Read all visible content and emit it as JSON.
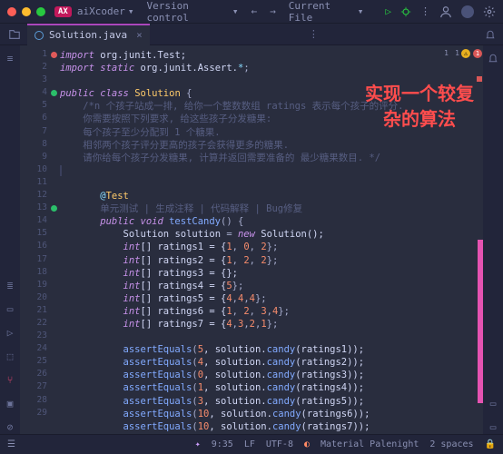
{
  "titlebar": {
    "brand_tag": "AX",
    "brand": "aiXcoder",
    "vc": "Version control",
    "run_cfg": "Current File"
  },
  "tab": {
    "name": "Solution.java"
  },
  "gutter": {
    "lines": [
      "1",
      "2",
      "3",
      "4",
      "5",
      "6",
      "7",
      "8",
      "9",
      "10",
      "11",
      "12",
      "13",
      "14",
      "15",
      "16",
      "17",
      "18",
      "19",
      "20",
      "21",
      "22",
      "23",
      "24",
      "25",
      "26",
      "27",
      "28",
      "29"
    ],
    "markers_active": [
      4,
      13
    ],
    "markers_error": [
      1
    ]
  },
  "code": {
    "l1a": "import",
    "l1b": " org.junit.Test;",
    "l2a": "import static",
    "l2b": " org.junit.Assert.",
    "l2c": "*",
    "l2d": ";",
    "l4a": "public class ",
    "l4b": "Solution",
    "l4c": " {",
    "l5": "    /*n 个孩子站成一排, 给你一个整数数组 ratings 表示每个孩子的评分.",
    "l6": "    你需要按照下列要求, 给这些孩子分发糖果:",
    "l7": "    每个孩子至少分配到 1 个糖果.",
    "l8": "    相邻两个孩子评分更高的孩子会获得更多的糖果.",
    "l9": "    请你给每个孩子分发糖果, 计算并返回需要准备的 最少糖果数目. */",
    "l10": "    ",
    "l12a": "       @",
    "l12b": "Test",
    "l13": "       单元测试 | 生成注释 | 代码解释 | Bug修复",
    "l14a": "       public void ",
    "l14b": "testCandy",
    "l14c": "() {",
    "l15a": "           Solution ",
    "l15b": "solution",
    "l15c": " = ",
    "l15d": "new",
    "l15e": " Solution();",
    "l16a": "           int",
    "l16b": "[] ratings1 = {",
    "l16c": "1",
    "l16d": ", ",
    "l16e": "0",
    "l16f": ", ",
    "l16g": "2",
    "l16h": "};",
    "l17a": "           int",
    "l17b": "[] ratings2 = {",
    "l17c": "1",
    "l17d": ", ",
    "l17e": "2",
    "l17f": ", ",
    "l17g": "2",
    "l17h": "};",
    "l18a": "           int",
    "l18b": "[] ratings3 = {};",
    "l19a": "           int",
    "l19b": "[] ratings4 = {",
    "l19c": "5",
    "l19d": "};",
    "l20a": "           int",
    "l20b": "[] ratings5 = {",
    "l20c": "4",
    "l20d": ",",
    "l20e": "4",
    "l20f": ",",
    "l20g": "4",
    "l20h": "};",
    "l21a": "           int",
    "l21b": "[] ratings6 = {",
    "l21c": "1",
    "l21d": ", ",
    "l21e": "2",
    "l21f": ", ",
    "l21g": "3",
    "l21h": ",",
    "l21i": "4",
    "l21j": "};",
    "l22a": "           int",
    "l22b": "[] ratings7 = {",
    "l22c": "4",
    "l22d": ",",
    "l22e": "3",
    "l22f": ",",
    "l22g": "2",
    "l22h": ",",
    "l22i": "1",
    "l22j": "};",
    "l24a": "           assertEquals",
    "l24b": "(",
    "l24c": "5",
    "l24d": ", solution.",
    "l24e": "candy",
    "l24f": "(ratings1));",
    "l25a": "           assertEquals",
    "l25b": "(",
    "l25c": "4",
    "l25d": ", solution.",
    "l25e": "candy",
    "l25f": "(ratings2));",
    "l26a": "           assertEquals",
    "l26b": "(",
    "l26c": "0",
    "l26d": ", solution.",
    "l26e": "candy",
    "l26f": "(ratings3));",
    "l27a": "           assertEquals",
    "l27b": "(",
    "l27c": "1",
    "l27d": ", solution.",
    "l27e": "candy",
    "l27f": "(ratings4));",
    "l28a": "           assertEquals",
    "l28b": "(",
    "l28c": "3",
    "l28d": ", solution.",
    "l28e": "candy",
    "l28f": "(ratings5));",
    "l29a": "           assertEquals",
    "l29b": "(",
    "l29c": "10",
    "l29d": ", solution.",
    "l29e": "candy",
    "l29f": "(ratings6));",
    "l30a": "           assertEquals",
    "l30b": "(",
    "l30c": "10",
    "l30d": ", solution.",
    "l30e": "candy",
    "l30f": "(ratings7));"
  },
  "overlay": {
    "line1": "实现一个较复",
    "line2": "杂的算法"
  },
  "markers": {
    "err_count": "1",
    "warn_count": "1",
    "weak_count": "1"
  },
  "status": {
    "cursor": "9:35",
    "lf": "LF",
    "enc": "UTF-8",
    "theme": "Material Palenight",
    "indent": "2 spaces"
  }
}
